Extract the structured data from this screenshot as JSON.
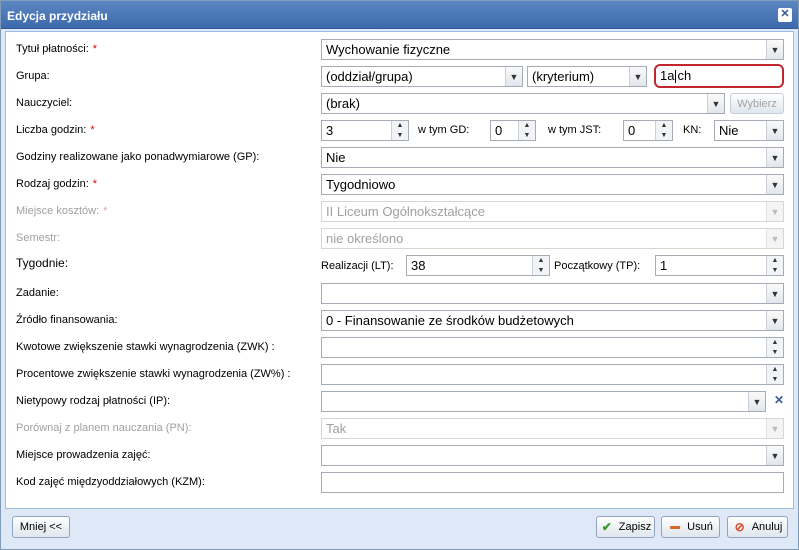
{
  "title": "Edycja przydziału",
  "close_label": "✕",
  "labels": {
    "tytul": "Tytuł płatności:",
    "grupa": "Grupa:",
    "nauczyciel": "Nauczyciel:",
    "liczba": "Liczba godzin:",
    "gp": "Godziny realizowane jako ponadwymiarowe (GP):",
    "rodzaj": "Rodzaj godzin:",
    "miejsce_kosztow": "Miejsce kosztów:",
    "semestr": "Semestr:",
    "tygodnie": "Tygodnie:",
    "zadanie": "Zadanie:",
    "zrodlo": "Źródło finansowania:",
    "zwk": "Kwotowe zwiększenie stawki wynagrodzenia (ZWK) :",
    "zwp": "Procentowe zwiększenie stawki wynagrodzenia (ZW%) :",
    "ip": "Nietypowy rodzaj płatności (IP):",
    "pn": "Porównaj z planem nauczania (PN):",
    "miejsce_zajec": "Miejsce prowadzenia zajęć:",
    "kzm": "Kod zajęć międzyoddziałowych (KZM):",
    "req": "*"
  },
  "values": {
    "tytul": "Wychowanie fizyczne",
    "oddzial": "(oddział/grupa)",
    "kryterium": "(kryterium)",
    "grupa_before": "1a",
    "grupa_after": "ch",
    "nauczyciel": "(brak)",
    "godziny": "3",
    "gd": "0",
    "jst": "0",
    "kn": "Nie",
    "gp": "Nie",
    "rodzaj": "Tygodniowo",
    "miejsce_kosztow": "II Liceum Ogólnokształcące",
    "semestr": "nie określono",
    "lt": "38",
    "tp": "1",
    "zadanie": "",
    "zrodlo": "0 - Finansowanie ze środków budżetowych",
    "zwk": "",
    "zwp": "",
    "ip": "",
    "pn": "Tak",
    "miejsce_zajec": "",
    "kzm": ""
  },
  "inline": {
    "w_tym_gd": "w tym GD:",
    "w_tym_jst": "w tym JST:",
    "kn": "KN:",
    "lt": "Realizacji (LT):",
    "tp": "Początkowy (TP):"
  },
  "buttons": {
    "wybierz": "Wybierz",
    "mniej": "Mniej <<",
    "zapisz": "Zapisz",
    "usun": "Usuń",
    "anuluj": "Anuluj"
  },
  "icons": {
    "dropdown": "▼",
    "spin_up": "▲",
    "spin_down": "▼",
    "clear": "✕",
    "check": "✔",
    "minus": "▬",
    "cancel": "⊘"
  },
  "colors": {
    "required": "#e00000",
    "highlight": "#c0282d",
    "title_bar": "#3d6aad"
  }
}
